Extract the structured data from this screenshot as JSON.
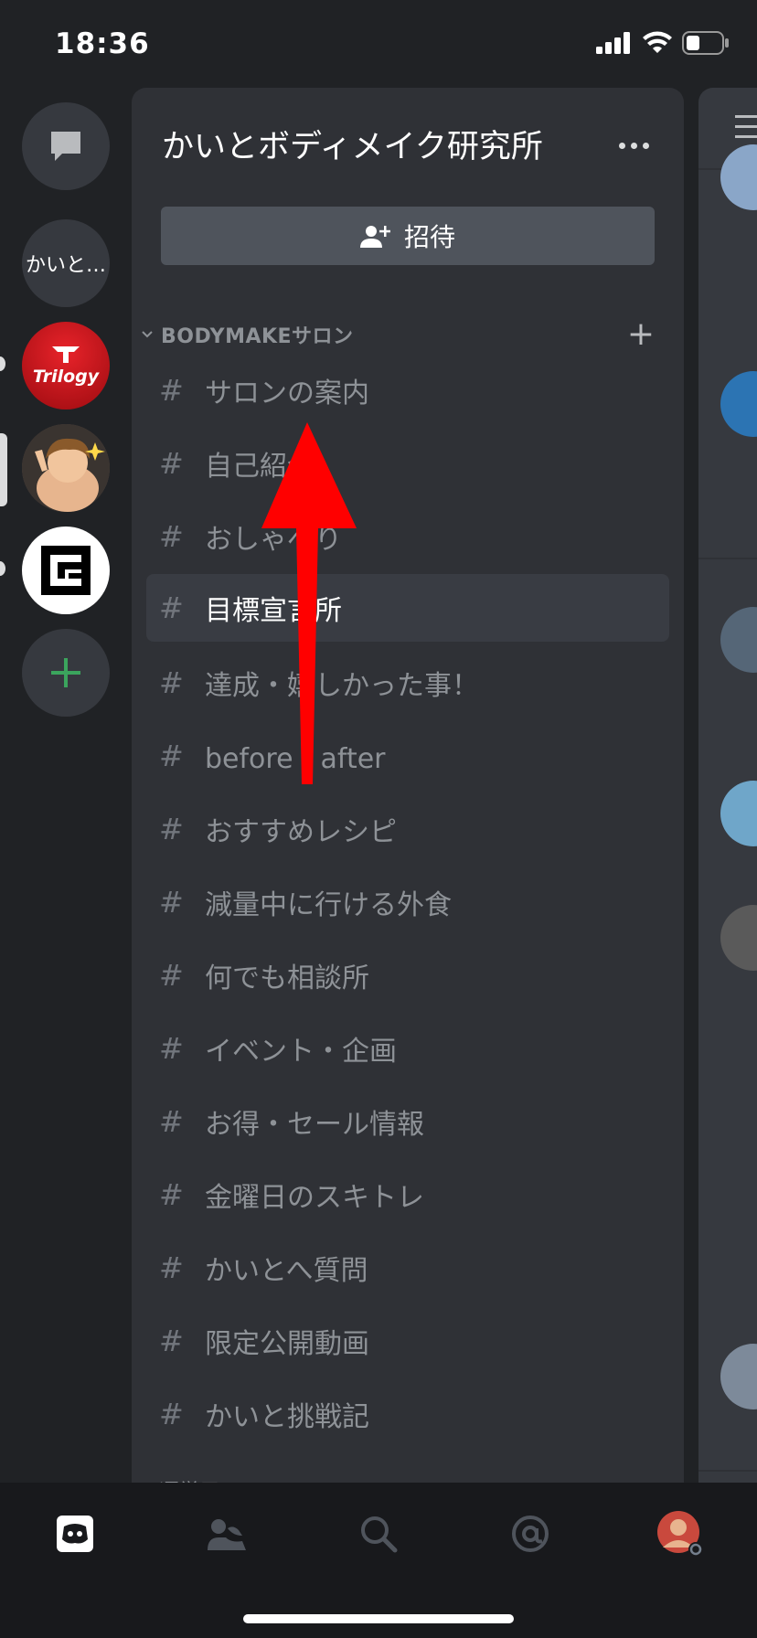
{
  "status_bar": {
    "time": "18:36"
  },
  "servers": [
    {
      "label": "かいと…"
    },
    {
      "label": "Trilogy"
    }
  ],
  "header": {
    "server_name": "かいとボディメイク研究所"
  },
  "invite_label": "招待",
  "category": {
    "label": "BODYMAKEサロン"
  },
  "channels": [
    {
      "name": "サロンの案内"
    },
    {
      "name": "自己紹介"
    },
    {
      "name": "おしゃべり"
    },
    {
      "name": "目標宣言所"
    },
    {
      "name": "達成・嬉しかった事！"
    },
    {
      "name": "before・after"
    },
    {
      "name": "おすすめレシピ"
    },
    {
      "name": "減量中に行ける外食"
    },
    {
      "name": "何でも相談所"
    },
    {
      "name": "イベント・企画"
    },
    {
      "name": "お得・セール情報"
    },
    {
      "name": "金曜日のスキトレ"
    },
    {
      "name": "かいとへ質問"
    },
    {
      "name": "限定公開動画"
    },
    {
      "name": "かいと挑戦記"
    }
  ],
  "category2": {
    "label": "運営用"
  },
  "colors": {
    "background": "#202225",
    "panel": "#2f3136",
    "accent_green": "#3ba55d",
    "arrow_red": "#ff0000"
  }
}
